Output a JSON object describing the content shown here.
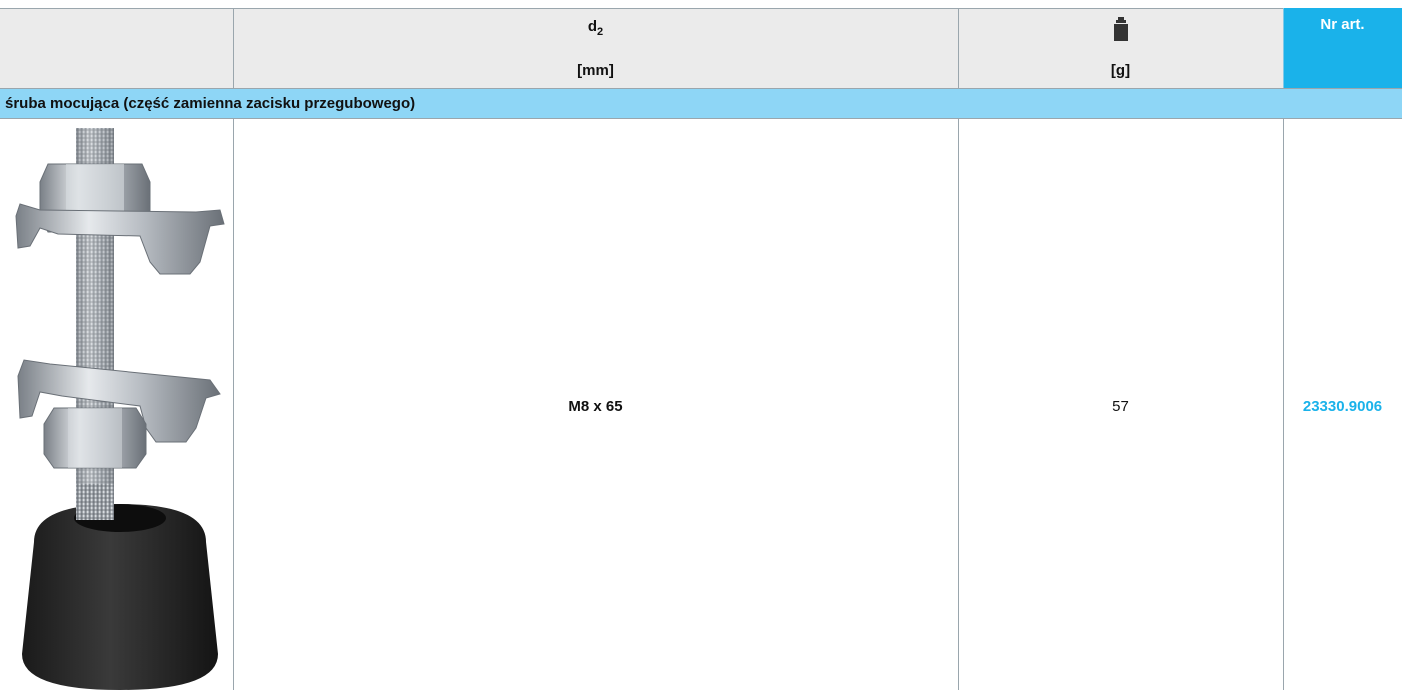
{
  "header": {
    "col_d2_symbol": "d",
    "col_d2_sub": "2",
    "col_d2_unit": "[mm]",
    "col_weight_icon": "weight-icon",
    "col_weight_unit": "[g]",
    "col_artnr_label": "Nr art."
  },
  "section": {
    "label": "śruba mocująca (część zamienna zacisku przegubowego)"
  },
  "rows": [
    {
      "image_icon": "screw-with-rubber-foot-image",
      "d2": "M8 x 65",
      "weight": "57",
      "art_nr": "23330.9006"
    }
  ],
  "colors": {
    "header_bg": "#ebebeb",
    "artnr_bg": "#1ab2ea",
    "section_bg": "#8ed6f6",
    "artnr_text": "#1ab2ea",
    "grid": "#9aa6ad"
  }
}
